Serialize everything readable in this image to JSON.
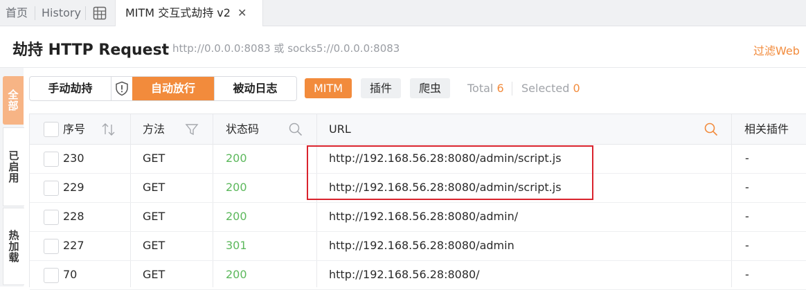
{
  "tabs": {
    "home": "首页",
    "history": "History",
    "active": "MITM 交互式劫持 v2",
    "close_glyph": "✕"
  },
  "header": {
    "title": "劫持 HTTP Request",
    "subtitle": "http://0.0.0.0:8083 或 socks5://0.0.0.0:8083",
    "filter_link": "过滤Web"
  },
  "side_tabs": [
    "全部",
    "已启用",
    "热加载"
  ],
  "toolbar": {
    "manual": "手动劫持",
    "auto": "自动放行",
    "passive": "被动日志",
    "mitm": "MITM",
    "plugin": "插件",
    "crawler": "爬虫",
    "total_label": "Total",
    "total_value": "6",
    "selected_label": "Selected",
    "selected_value": "0"
  },
  "table": {
    "columns": [
      "序号",
      "方法",
      "状态码",
      "URL",
      "相关插件"
    ],
    "rows": [
      {
        "id": "230",
        "method": "GET",
        "status": "200",
        "url": "http://192.168.56.28:8080/admin/script.js",
        "plugin": "-"
      },
      {
        "id": "229",
        "method": "GET",
        "status": "200",
        "url": "http://192.168.56.28:8080/admin/script.js",
        "plugin": "-"
      },
      {
        "id": "228",
        "method": "GET",
        "status": "200",
        "url": "http://192.168.56.28:8080/admin/",
        "plugin": "-"
      },
      {
        "id": "227",
        "method": "GET",
        "status": "301",
        "url": "http://192.168.56.28:8080/admin",
        "plugin": "-"
      },
      {
        "id": "70",
        "method": "GET",
        "status": "200",
        "url": "http://192.168.56.28:8080/",
        "plugin": "-"
      }
    ]
  },
  "colors": {
    "accent": "#f28b3c",
    "status_ok": "#5cb85c",
    "highlight": "#d9232d"
  },
  "icons": [
    "grid-icon",
    "close-icon",
    "shield-icon",
    "sort-icon",
    "filter-icon",
    "search-icon"
  ]
}
